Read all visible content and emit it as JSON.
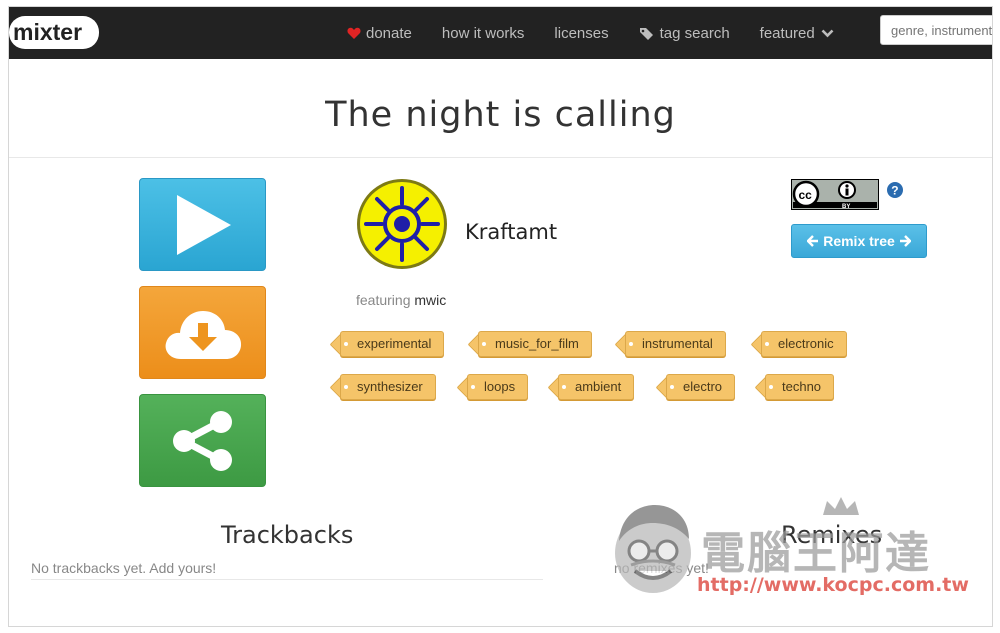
{
  "navbar": {
    "logo_text": "mixter",
    "items": [
      {
        "label": "donate",
        "icon": "heart-icon"
      },
      {
        "label": "how it works"
      },
      {
        "label": "licenses"
      },
      {
        "label": "tag search",
        "icon": "tag-icon"
      },
      {
        "label": "featured",
        "icon": "chevron-down-icon"
      }
    ],
    "search_placeholder": "genre, instrument"
  },
  "title": "The night is calling",
  "actions": {
    "play_icon": "play-icon",
    "download_icon": "cloud-download-icon",
    "share_icon": "share-icon"
  },
  "artist": {
    "name": "Kraftamt",
    "featuring_label": "featuring",
    "featuring_name": "mwic"
  },
  "tags": [
    "experimental",
    "music_for_film",
    "instrumental",
    "electronic",
    "synthesizer",
    "loops",
    "ambient",
    "electro",
    "techno"
  ],
  "license": {
    "badge": "BY",
    "help": "?"
  },
  "remix_button": "Remix tree",
  "trackbacks": {
    "title": "Trackbacks",
    "empty": "No trackbacks yet. Add yours!"
  },
  "remixes": {
    "title": "Remixes",
    "empty": "no remixes yet!"
  },
  "watermark": {
    "text": "電腦王阿達",
    "url": "http://www.kocpc.com.tw"
  },
  "colors": {
    "navbar": "#222222",
    "play": "#35b0dc",
    "download": "#f09a2a",
    "share": "#47a64d",
    "tag": "#f5c469",
    "remix": "#4ab4e0"
  }
}
